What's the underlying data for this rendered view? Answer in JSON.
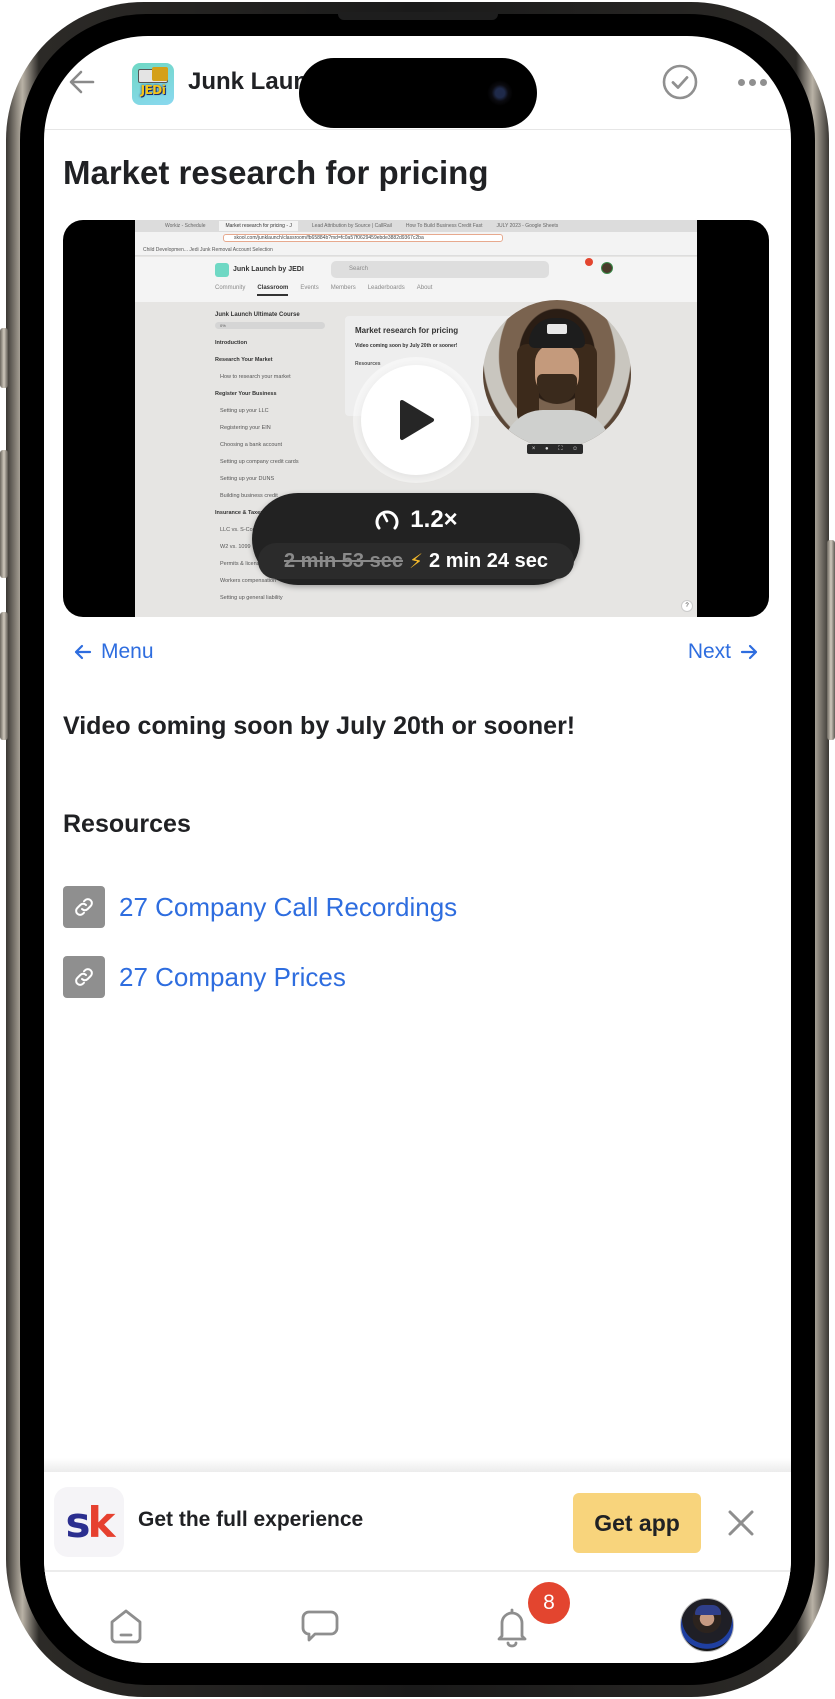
{
  "header": {
    "group_name": "Junk Launch by JEDI",
    "group_name_visible": "Junk Laun",
    "logo_text": "JEDi"
  },
  "lesson": {
    "title": "Market research for pricing",
    "description": "Video coming soon by July 20th or sooner!"
  },
  "video": {
    "speed": "1.2×",
    "original_duration": "2 min 53 sec",
    "fast_duration": "2 min 24 sec",
    "recording": {
      "browser_tabs": [
        "Workiz - Schedule",
        "Market research for pricing - J",
        "Lead Attribution by Source | CallRail",
        "How To Build Business Credit Fast",
        "JULY 2023 - Google Sheets"
      ],
      "url": "skool.com/junklaunch/classroom/fb65884b?md=fc0a57f0629459ebde3882d9367c2ba",
      "bookmarks": "Child Developmen...   Jedi Junk Removal   Account Selection",
      "site_name": "Junk Launch by JEDI",
      "search_placeholder": "Search",
      "site_nav": [
        "Community",
        "Classroom",
        "Events",
        "Members",
        "Leaderboards",
        "About"
      ],
      "course_title": "Junk Launch Ultimate Course",
      "course_progress": "0%",
      "sidebar": [
        {
          "type": "section",
          "label": "Introduction"
        },
        {
          "type": "section",
          "label": "Research Your Market"
        },
        {
          "type": "item",
          "label": "How to research your market"
        },
        {
          "type": "section",
          "label": "Register Your Business"
        },
        {
          "type": "item",
          "label": "Setting up your LLC"
        },
        {
          "type": "item",
          "label": "Registering your EIN"
        },
        {
          "type": "item",
          "label": "Choosing a bank account"
        },
        {
          "type": "item",
          "label": "Setting up company credit cards"
        },
        {
          "type": "item",
          "label": "Setting up your DUNS"
        },
        {
          "type": "item",
          "label": "Building business credit"
        },
        {
          "type": "section",
          "label": "Insurance & Taxes"
        },
        {
          "type": "item",
          "label": "LLC vs. S-Corp"
        },
        {
          "type": "item",
          "label": "W2 vs. 1099"
        },
        {
          "type": "item",
          "label": "Permits & licenses"
        },
        {
          "type": "item",
          "label": "Workers compensation"
        },
        {
          "type": "item",
          "label": "Setting up general liability"
        }
      ],
      "card_title": "Market research for pricing",
      "card_subtitle": "Video coming soon by July 20th or sooner!",
      "card_resources": "Resources",
      "help": "?"
    }
  },
  "navigation": {
    "menu_label": "Menu",
    "next_label": "Next"
  },
  "resources": {
    "title": "Resources",
    "items": [
      {
        "label": "27 Company Call Recordings",
        "icon": "link-icon"
      },
      {
        "label": "27 Company Prices",
        "icon": "link-icon"
      }
    ]
  },
  "app_banner": {
    "logo_s": "s",
    "logo_k": "k",
    "text": "Get the full experience",
    "button_label": "Get app"
  },
  "tabbar": {
    "items": [
      {
        "name": "home",
        "icon": "home-icon"
      },
      {
        "name": "chat",
        "icon": "chat-icon"
      },
      {
        "name": "notifications",
        "icon": "bell-icon",
        "badge": "8"
      },
      {
        "name": "profile",
        "icon": "avatar"
      }
    ]
  },
  "colors": {
    "link_blue": "#2e6ddf",
    "get_app_yellow": "#f8d47c",
    "badge_red": "#e3452f",
    "text_dark": "#202124",
    "icon_gray": "#909090",
    "speed_pill": "#222222",
    "bolt_yellow": "#f3b82a",
    "sk_blue": "#2b2e8f",
    "sk_red": "#e6402f"
  }
}
